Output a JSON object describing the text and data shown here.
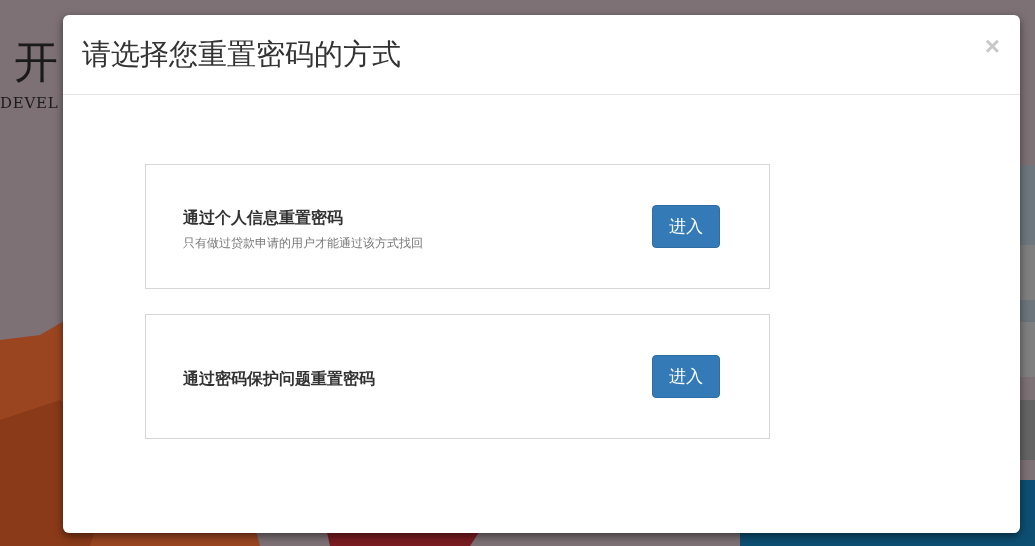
{
  "background": {
    "logo_text": "开",
    "logo_subtitle": "DEVEL"
  },
  "dialog": {
    "title": "请选择您重置密码的方式",
    "close": "×",
    "options": [
      {
        "title": "通过个人信息重置密码",
        "description": "只有做过贷款申请的用户才能通过该方式找回",
        "button": "进入"
      },
      {
        "title": "通过密码保护问题重置密码",
        "button": "进入"
      }
    ]
  }
}
